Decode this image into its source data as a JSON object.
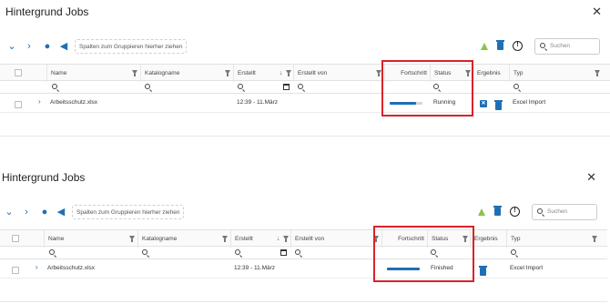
{
  "panels": [
    {
      "title": "Hintergrund Jobs",
      "close_glyph": "✕",
      "toolbar": {
        "group_placeholder": "Spalten zum Gruppieren hierher ziehen",
        "search_placeholder": "Suchen",
        "icons": [
          "chevron-down-icon",
          "chevron-right-icon",
          "user-icon",
          "megaphone-icon",
          "warning-icon",
          "trash-icon",
          "help-icon",
          "search-icon"
        ]
      },
      "columns": [
        "Name",
        "Katalogname",
        "Erstellt",
        "Erstellt von",
        "Fortschritt",
        "Status",
        "Ergebnis",
        "Typ"
      ],
      "sort_indicator": "↓",
      "row": {
        "name": "Arbeitsschutz.xlsx",
        "katalogname": "",
        "erstellt": "12:39 - 11.März",
        "erstellt_von": "",
        "progress": 0.8,
        "status": "Running",
        "typ": "Excel Import",
        "ergebnis_icons": [
          "close-box-icon",
          "trash-icon"
        ]
      },
      "highlight_color": "#d8232a"
    },
    {
      "title": "Hintergrund Jobs",
      "close_glyph": "✕",
      "toolbar": {
        "group_placeholder": "Spalten zum Gruppieren hierher ziehen",
        "search_placeholder": "Suchen",
        "icons": [
          "chevron-down-icon",
          "chevron-right-icon",
          "user-icon",
          "megaphone-icon",
          "warning-icon",
          "trash-icon",
          "help-icon",
          "search-icon"
        ]
      },
      "columns": [
        "Name",
        "Katalogname",
        "Erstellt",
        "Erstellt von",
        "Fortschritt",
        "Status",
        "Ergebnis",
        "Typ"
      ],
      "sort_indicator": "↓",
      "row": {
        "name": "Arbeitsschutz.xlsx",
        "katalogname": "",
        "erstellt": "12:39 - 11.März",
        "erstellt_von": "",
        "progress": 1.0,
        "status": "Finished",
        "typ": "Excel Import",
        "ergebnis_icons": [
          "trash-icon"
        ]
      },
      "highlight_color": "#d8232a"
    }
  ],
  "colors": {
    "accent": "#1f6fb5",
    "warning": "#8cc34a",
    "highlight": "#d8232a"
  }
}
